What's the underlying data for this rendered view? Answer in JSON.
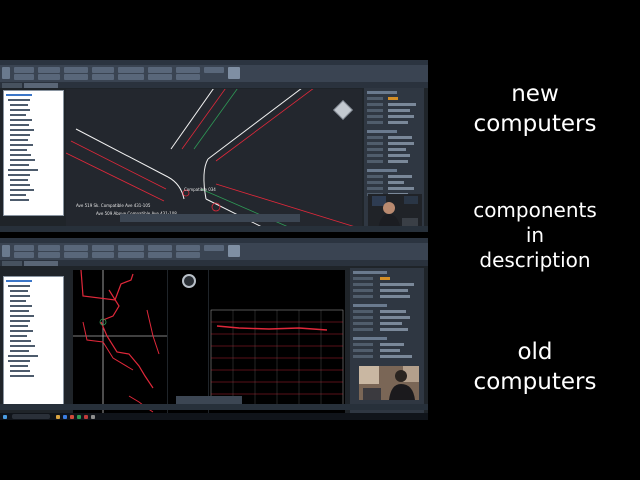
{
  "captions": {
    "new_line1": "new",
    "new_line2": "computers",
    "comp_line1": "components",
    "comp_line2": "in",
    "comp_line3": "description",
    "old_line1": "old",
    "old_line2": "computers"
  },
  "top_window": {
    "annotation_1": "Ave 519 Sk. Compatible Ave 431-105",
    "annotation_2": "Ave 509 Above Compatible Ave 431-108",
    "annotation_3": "Compatible 034"
  },
  "colors": {
    "background": "#000000",
    "caption": "#ffffff",
    "cad_viewport": "#23272e",
    "cad_black": "#000000",
    "road_red": "#e0283a",
    "road_white": "#f2f2f2",
    "road_green": "#2e9a56",
    "ribbon": "#3a4452",
    "accent_orange": "#d58f26"
  },
  "icons": [
    "view-cube-icon",
    "nav-wheel-icon",
    "windows-start-icon",
    "search-icon"
  ]
}
